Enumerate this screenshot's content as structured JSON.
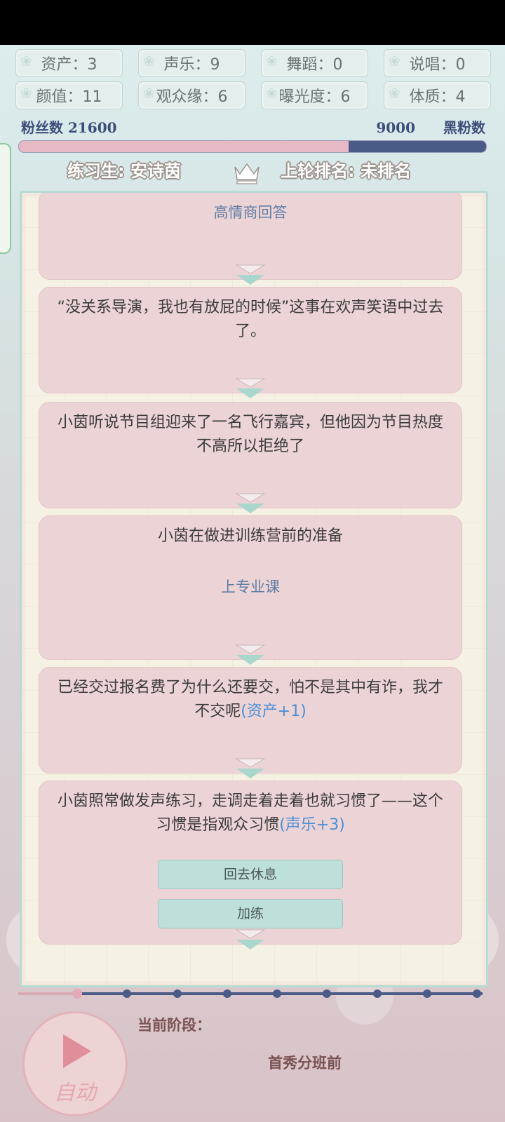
{
  "stats": [
    {
      "label": "资产：3"
    },
    {
      "label": "声乐：9"
    },
    {
      "label": "舞蹈：0"
    },
    {
      "label": "说唱：0"
    },
    {
      "label": "颜值：11"
    },
    {
      "label": "观众缘：6"
    },
    {
      "label": "曝光度：6"
    },
    {
      "label": "体质：4"
    }
  ],
  "fans": {
    "fans_label": "粉丝数",
    "fans_value": "21600",
    "anti_value": "9000",
    "anti_label": "黑粉数",
    "fans_fraction": 0.706
  },
  "trainee": {
    "name_label": "练习生: 安诗茵",
    "rank_label": "上轮排名: 未排名",
    "crown_icon": "crown-icon"
  },
  "story": {
    "cards": [
      {
        "option": "高情商回答"
      },
      {
        "text": "“没关系导演，我也有放屁的时候”这事在欢声笑语中过去了。"
      },
      {
        "text": "小茵听说节目组迎来了一名飞行嘉宾，但他因为节目热度不高所以拒绝了"
      },
      {
        "text": "小茵在做进训练营前的准备",
        "option": "上专业课"
      },
      {
        "text": "已经交过报名费了为什么还要交，怕不是其中有诈，我才不交呢",
        "bonus": "(资产+1)"
      },
      {
        "text": "小茵照常做发声练习，走调走着走着也就习惯了——这个习惯是指观众习惯",
        "bonus": "(声乐+3)"
      }
    ],
    "choices": [
      "回去休息",
      "加练"
    ]
  },
  "timeline": {
    "total_nodes": 9,
    "current_node": 1
  },
  "stage": {
    "label": "当前阶段：",
    "value": "首秀分班前"
  },
  "auto_button": {
    "label": "自动",
    "icon": "play-icon"
  },
  "colors": {
    "accent_navy": "#4a5b88",
    "fan_pink": "#e7b9c4",
    "card_pink": "#ecd3d6",
    "choice_teal": "#bee0da",
    "bonus_blue": "#4a8fd6"
  }
}
